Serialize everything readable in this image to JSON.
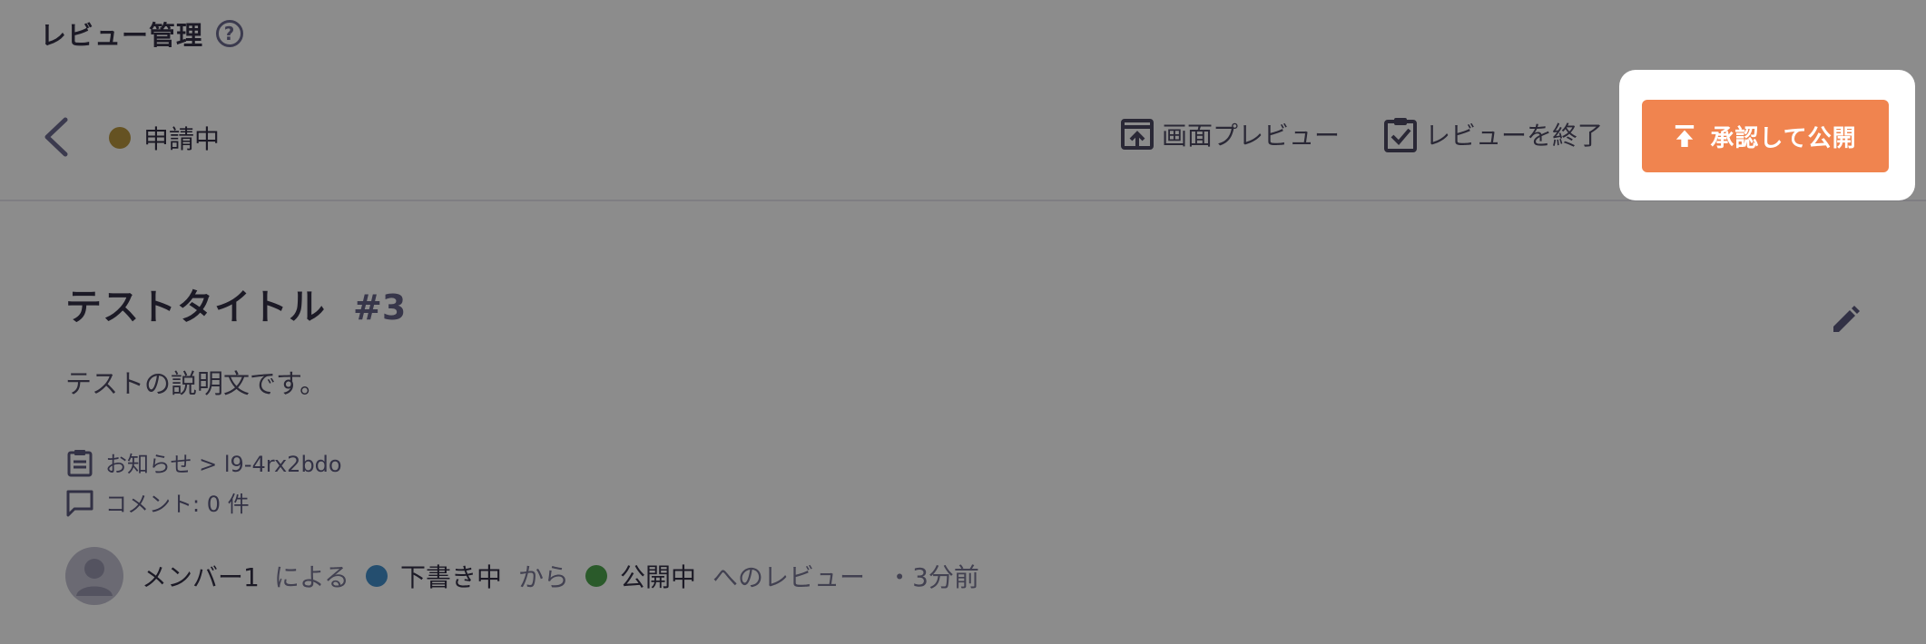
{
  "header": {
    "title": "レビュー管理",
    "help_glyph": "?"
  },
  "toolbar": {
    "status_label": "申請中",
    "status_color": "#b08a2a",
    "preview_label": "画面プレビュー",
    "finish_label": "レビューを終了",
    "approve_label": "承認して公開",
    "approve_color": "#f0844f"
  },
  "content": {
    "title": "テストタイトル",
    "number": "#3",
    "description": "テストの説明文です。",
    "category_path": "お知らせ > l9-4rx2bdo",
    "comments": "コメント: 0 件"
  },
  "review": {
    "member": "メンバー1",
    "by": "による",
    "from_state": "下書き中",
    "from_color": "#2f83c4",
    "from": "から",
    "to_state": "公開中",
    "to_color": "#3b9a3b",
    "to_review": "へのレビュー",
    "ago": "・3分前"
  },
  "icons": [
    "help-icon",
    "back-arrow-icon",
    "preview-upload-icon",
    "clipboard-check-icon",
    "upload-icon",
    "pencil-icon",
    "clipboard-list-icon",
    "comment-icon",
    "person-icon"
  ]
}
